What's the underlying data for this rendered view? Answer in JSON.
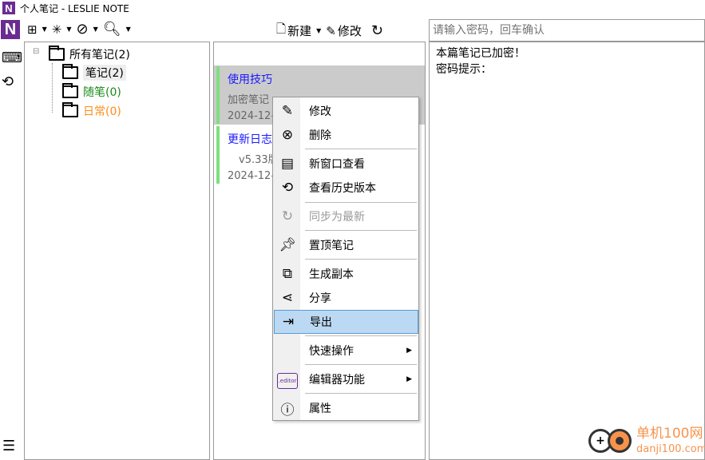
{
  "window": {
    "title": "个人笔记 - LESLIE NOTE",
    "logo": "N"
  },
  "toolbar": {
    "new_label": "新建",
    "edit_label": "修改",
    "password_placeholder": "请输入密码，回车确认"
  },
  "tree": {
    "root": "所有笔记(2)",
    "items": [
      {
        "label": "笔记(2)",
        "color": "#000000"
      },
      {
        "label": "随笔(0)",
        "color": "#1a8a1a"
      },
      {
        "label": "日常(0)",
        "color": "#ff8c1a"
      }
    ]
  },
  "notes": [
    {
      "title": "使用技巧",
      "summary": "加密笔记",
      "date": "2024-12-"
    },
    {
      "title": "更新日志",
      "summary": "v5.33版",
      "date": "2024-12-"
    }
  ],
  "content": {
    "line1": "本篇笔记已加密！",
    "line2": "密码提示："
  },
  "menu": {
    "items": [
      {
        "label": "修改",
        "icon": "edit-icon"
      },
      {
        "label": "删除",
        "icon": "delete-circle-icon"
      },
      {
        "label": "新窗口查看",
        "icon": "window-icon"
      },
      {
        "label": "查看历史版本",
        "icon": "history-icon"
      },
      {
        "label": "同步为最新",
        "icon": "sync-icon",
        "disabled": true
      },
      {
        "label": "置顶笔记",
        "icon": "pin-icon"
      },
      {
        "label": "生成副本",
        "icon": "copy-icon"
      },
      {
        "label": "分享",
        "icon": "share-icon"
      },
      {
        "label": "导出",
        "icon": "export-icon",
        "highlighted": true
      },
      {
        "label": "快速操作",
        "submenu": true
      },
      {
        "label": "编辑器功能",
        "icon": "editor-icon",
        "icon_text": ".editor",
        "submenu": true
      },
      {
        "label": "属性",
        "icon": "info-icon"
      }
    ]
  },
  "watermark": {
    "name": "单机100网",
    "url": "danji100.com"
  }
}
